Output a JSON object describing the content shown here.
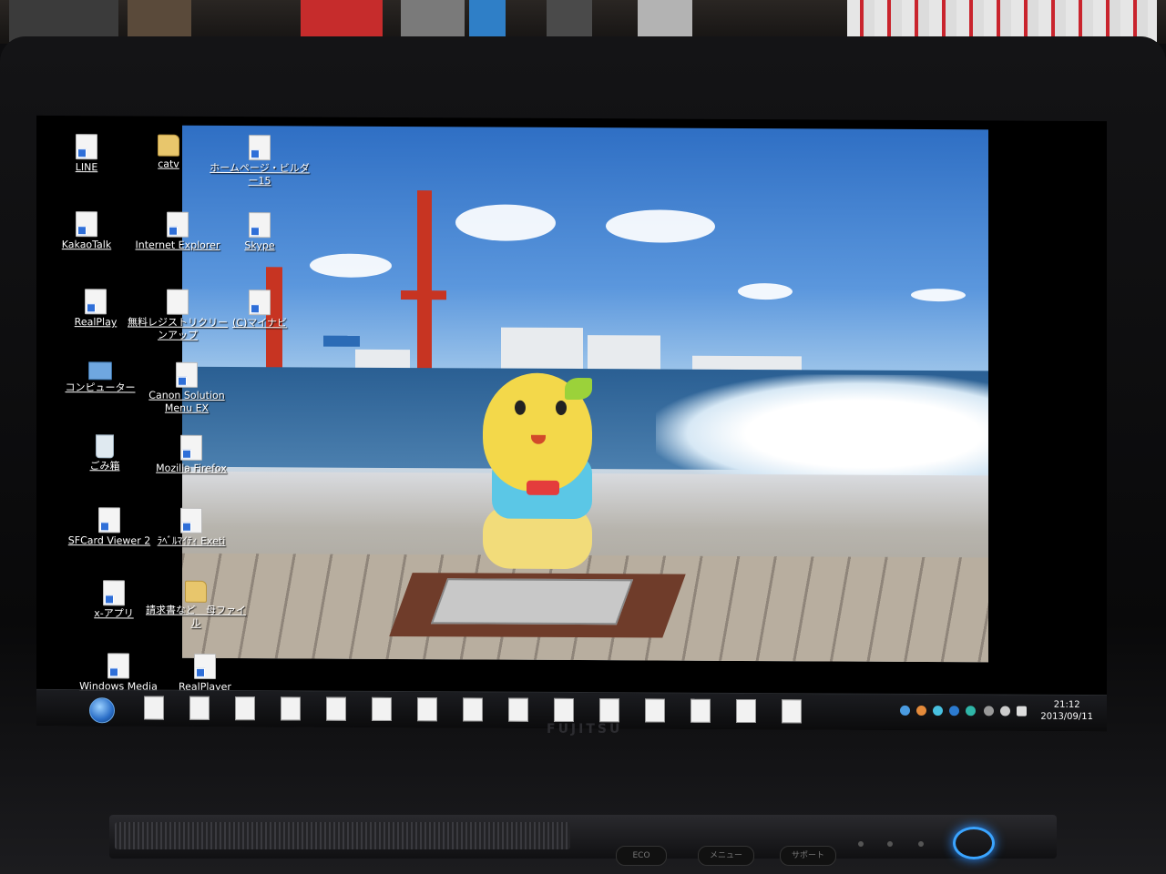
{
  "desktop": {
    "icons": [
      {
        "label": "LINE",
        "type": "shortcut"
      },
      {
        "label": "catv",
        "type": "folder"
      },
      {
        "label": "ホームページ・ビルダー15",
        "type": "shortcut"
      },
      {
        "label": "KakaoTalk",
        "type": "shortcut"
      },
      {
        "label": "Internet Explorer",
        "type": "shortcut"
      },
      {
        "label": "Skype",
        "type": "shortcut"
      },
      {
        "label": "RealPlay",
        "type": "shortcut"
      },
      {
        "label": "無料レジストリクリーンアップ",
        "type": "document"
      },
      {
        "label": "(C)マイナビ",
        "type": "shortcut"
      },
      {
        "label": "コンピューター",
        "type": "pc"
      },
      {
        "label": "Canon Solution Menu EX",
        "type": "shortcut"
      },
      {
        "label": "ごみ箱",
        "type": "trash"
      },
      {
        "label": "Mozilla Firefox",
        "type": "shortcut"
      },
      {
        "label": "SFCard Viewer 2",
        "type": "shortcut"
      },
      {
        "label": "ﾗﾍﾞﾙﾏｲﾃｨ Exeti",
        "type": "shortcut"
      },
      {
        "label": "x-アプリ",
        "type": "shortcut"
      },
      {
        "label": "請求書など　母ファイル",
        "type": "folder"
      },
      {
        "label": "Windows Media Player",
        "type": "shortcut"
      },
      {
        "label": "RealPlayer",
        "type": "shortcut"
      }
    ]
  },
  "taskbar": {
    "time": "21:12",
    "date": "2013/09/11"
  },
  "hardware": {
    "brand": "FUJITSU",
    "btn_eco": "ECO",
    "btn_menu": "メニュー",
    "btn_support": "サポート"
  },
  "colors": {
    "accent_power": "#3aa4ff",
    "taskbar": "#0b0b0c"
  }
}
